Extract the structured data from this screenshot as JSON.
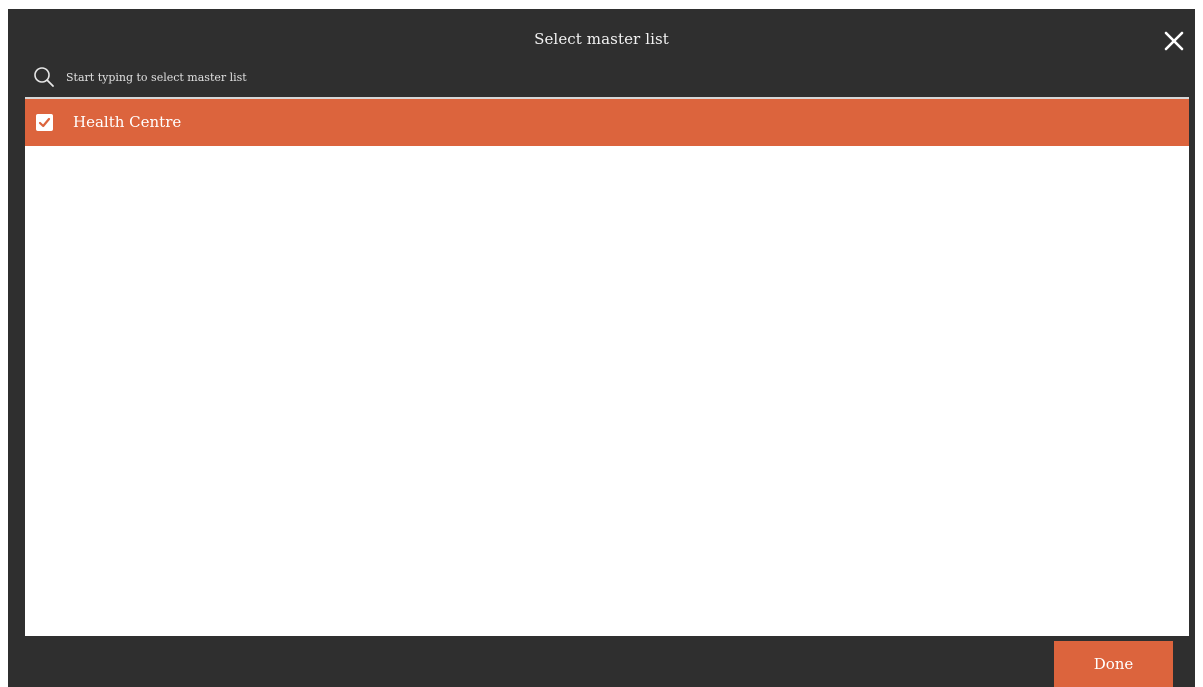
{
  "dialog": {
    "title": "Select master list",
    "close_icon": "close-icon"
  },
  "search": {
    "icon": "search-icon",
    "placeholder": "Start typing to select master list",
    "value": ""
  },
  "list": {
    "items": [
      {
        "label": "Health Centre",
        "checked": true,
        "selected": true
      }
    ]
  },
  "footer": {
    "done_label": "Done"
  },
  "colors": {
    "accent": "#dc643d",
    "dialog_background": "#2f2f2f",
    "list_background": "#ffffff"
  }
}
